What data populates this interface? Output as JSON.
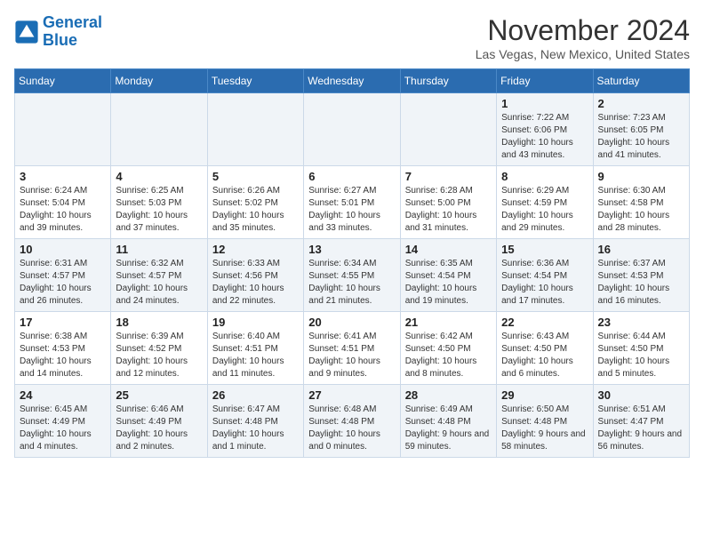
{
  "logo": {
    "line1": "General",
    "line2": "Blue"
  },
  "title": "November 2024",
  "location": "Las Vegas, New Mexico, United States",
  "days_of_week": [
    "Sunday",
    "Monday",
    "Tuesday",
    "Wednesday",
    "Thursday",
    "Friday",
    "Saturday"
  ],
  "weeks": [
    [
      {
        "day": "",
        "info": ""
      },
      {
        "day": "",
        "info": ""
      },
      {
        "day": "",
        "info": ""
      },
      {
        "day": "",
        "info": ""
      },
      {
        "day": "",
        "info": ""
      },
      {
        "day": "1",
        "info": "Sunrise: 7:22 AM\nSunset: 6:06 PM\nDaylight: 10 hours and 43 minutes."
      },
      {
        "day": "2",
        "info": "Sunrise: 7:23 AM\nSunset: 6:05 PM\nDaylight: 10 hours and 41 minutes."
      }
    ],
    [
      {
        "day": "3",
        "info": "Sunrise: 6:24 AM\nSunset: 5:04 PM\nDaylight: 10 hours and 39 minutes."
      },
      {
        "day": "4",
        "info": "Sunrise: 6:25 AM\nSunset: 5:03 PM\nDaylight: 10 hours and 37 minutes."
      },
      {
        "day": "5",
        "info": "Sunrise: 6:26 AM\nSunset: 5:02 PM\nDaylight: 10 hours and 35 minutes."
      },
      {
        "day": "6",
        "info": "Sunrise: 6:27 AM\nSunset: 5:01 PM\nDaylight: 10 hours and 33 minutes."
      },
      {
        "day": "7",
        "info": "Sunrise: 6:28 AM\nSunset: 5:00 PM\nDaylight: 10 hours and 31 minutes."
      },
      {
        "day": "8",
        "info": "Sunrise: 6:29 AM\nSunset: 4:59 PM\nDaylight: 10 hours and 29 minutes."
      },
      {
        "day": "9",
        "info": "Sunrise: 6:30 AM\nSunset: 4:58 PM\nDaylight: 10 hours and 28 minutes."
      }
    ],
    [
      {
        "day": "10",
        "info": "Sunrise: 6:31 AM\nSunset: 4:57 PM\nDaylight: 10 hours and 26 minutes."
      },
      {
        "day": "11",
        "info": "Sunrise: 6:32 AM\nSunset: 4:57 PM\nDaylight: 10 hours and 24 minutes."
      },
      {
        "day": "12",
        "info": "Sunrise: 6:33 AM\nSunset: 4:56 PM\nDaylight: 10 hours and 22 minutes."
      },
      {
        "day": "13",
        "info": "Sunrise: 6:34 AM\nSunset: 4:55 PM\nDaylight: 10 hours and 21 minutes."
      },
      {
        "day": "14",
        "info": "Sunrise: 6:35 AM\nSunset: 4:54 PM\nDaylight: 10 hours and 19 minutes."
      },
      {
        "day": "15",
        "info": "Sunrise: 6:36 AM\nSunset: 4:54 PM\nDaylight: 10 hours and 17 minutes."
      },
      {
        "day": "16",
        "info": "Sunrise: 6:37 AM\nSunset: 4:53 PM\nDaylight: 10 hours and 16 minutes."
      }
    ],
    [
      {
        "day": "17",
        "info": "Sunrise: 6:38 AM\nSunset: 4:53 PM\nDaylight: 10 hours and 14 minutes."
      },
      {
        "day": "18",
        "info": "Sunrise: 6:39 AM\nSunset: 4:52 PM\nDaylight: 10 hours and 12 minutes."
      },
      {
        "day": "19",
        "info": "Sunrise: 6:40 AM\nSunset: 4:51 PM\nDaylight: 10 hours and 11 minutes."
      },
      {
        "day": "20",
        "info": "Sunrise: 6:41 AM\nSunset: 4:51 PM\nDaylight: 10 hours and 9 minutes."
      },
      {
        "day": "21",
        "info": "Sunrise: 6:42 AM\nSunset: 4:50 PM\nDaylight: 10 hours and 8 minutes."
      },
      {
        "day": "22",
        "info": "Sunrise: 6:43 AM\nSunset: 4:50 PM\nDaylight: 10 hours and 6 minutes."
      },
      {
        "day": "23",
        "info": "Sunrise: 6:44 AM\nSunset: 4:50 PM\nDaylight: 10 hours and 5 minutes."
      }
    ],
    [
      {
        "day": "24",
        "info": "Sunrise: 6:45 AM\nSunset: 4:49 PM\nDaylight: 10 hours and 4 minutes."
      },
      {
        "day": "25",
        "info": "Sunrise: 6:46 AM\nSunset: 4:49 PM\nDaylight: 10 hours and 2 minutes."
      },
      {
        "day": "26",
        "info": "Sunrise: 6:47 AM\nSunset: 4:48 PM\nDaylight: 10 hours and 1 minute."
      },
      {
        "day": "27",
        "info": "Sunrise: 6:48 AM\nSunset: 4:48 PM\nDaylight: 10 hours and 0 minutes."
      },
      {
        "day": "28",
        "info": "Sunrise: 6:49 AM\nSunset: 4:48 PM\nDaylight: 9 hours and 59 minutes."
      },
      {
        "day": "29",
        "info": "Sunrise: 6:50 AM\nSunset: 4:48 PM\nDaylight: 9 hours and 58 minutes."
      },
      {
        "day": "30",
        "info": "Sunrise: 6:51 AM\nSunset: 4:47 PM\nDaylight: 9 hours and 56 minutes."
      }
    ]
  ]
}
